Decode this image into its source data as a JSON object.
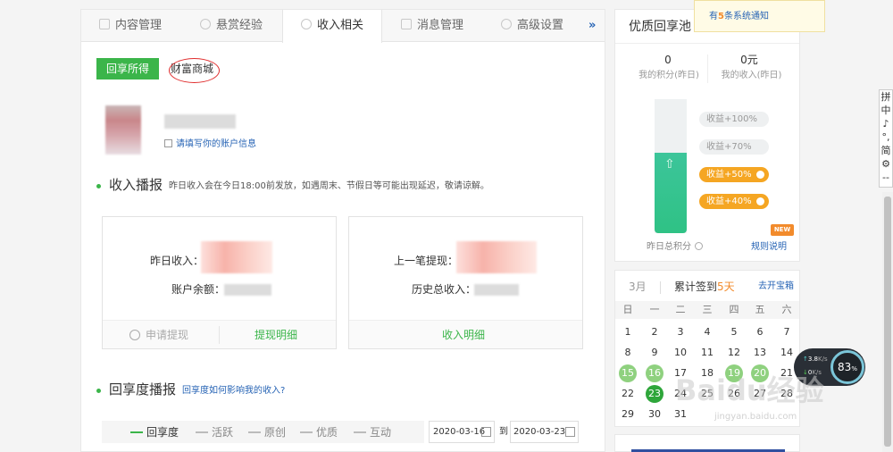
{
  "tabs": {
    "content": "内容管理",
    "reward": "悬赏经验",
    "income": "收入相关",
    "message": "消息管理",
    "advanced": "高级设置",
    "more": "»"
  },
  "subtabs": {
    "share": "回享所得",
    "wealth": "财富商城"
  },
  "account": {
    "fill_info": "请填写你的账户信息"
  },
  "income_report": {
    "title": "收入播报",
    "note": "昨日收入会在今日18:00前发放，如遇周末、节假日等可能出现延迟，敬请谅解。"
  },
  "card_left": {
    "yesterday": "昨日收入：",
    "balance": "账户余额：",
    "apply": "申请提现",
    "detail": "提现明细"
  },
  "card_right": {
    "last": "上一笔提现：",
    "total": "历史总收入：",
    "detail": "收入明细"
  },
  "share_report": {
    "title": "回享度播报",
    "link": "回享度如何影响我的收入?"
  },
  "legend": [
    "回享度",
    "活跃",
    "原创",
    "优质",
    "互动"
  ],
  "date_range": {
    "from": "2020-03-16",
    "to_label": "到",
    "to": "2020-03-23"
  },
  "pool": {
    "title": "优质回享池",
    "points_value": "0",
    "points_label": "我的积分(昨日)",
    "income_value": "0元",
    "income_label": "我的收入(昨日)",
    "pill1": "收益+100%",
    "pill2": "收益+70%",
    "pill3": "收益+50%",
    "pill4": "收益+40%",
    "yesterday_total": "昨日总积分",
    "rules": "规则说明",
    "new_badge": "NEW"
  },
  "notice": {
    "prefix": "有",
    "count": "5",
    "suffix": "条系统通知"
  },
  "calendar": {
    "month": "3月",
    "signed_prefix": "累计签到",
    "signed_days": "5天",
    "open_box": "去开宝箱",
    "weekdays": [
      "日",
      "一",
      "二",
      "三",
      "四",
      "五",
      "六"
    ],
    "rows": [
      [
        "1",
        "2",
        "3",
        "4",
        "5",
        "6",
        "7"
      ],
      [
        "8",
        "9",
        "10",
        "11",
        "12",
        "13",
        "14"
      ],
      [
        "15",
        "16",
        "17",
        "18",
        "19",
        "20",
        "21"
      ],
      [
        "22",
        "23",
        "24",
        "25",
        "26",
        "27",
        "28"
      ],
      [
        "29",
        "30",
        "31",
        "",
        "",
        "",
        ""
      ]
    ]
  },
  "speed": {
    "up": "3.8",
    "up_unit": "K/s",
    "down": "0",
    "down_unit": "K/s",
    "percent": "83",
    "percent_sign": "%"
  },
  "ime": [
    "拼",
    "中",
    "♪",
    "°,",
    "简",
    "⚙",
    "‑‑"
  ],
  "watermark": {
    "brand": "Baidu经验",
    "url": "jingyan.baidu.com"
  },
  "colors": {
    "accent": "#3bb54a",
    "link": "#2764b5",
    "orange": "#f5a623"
  }
}
